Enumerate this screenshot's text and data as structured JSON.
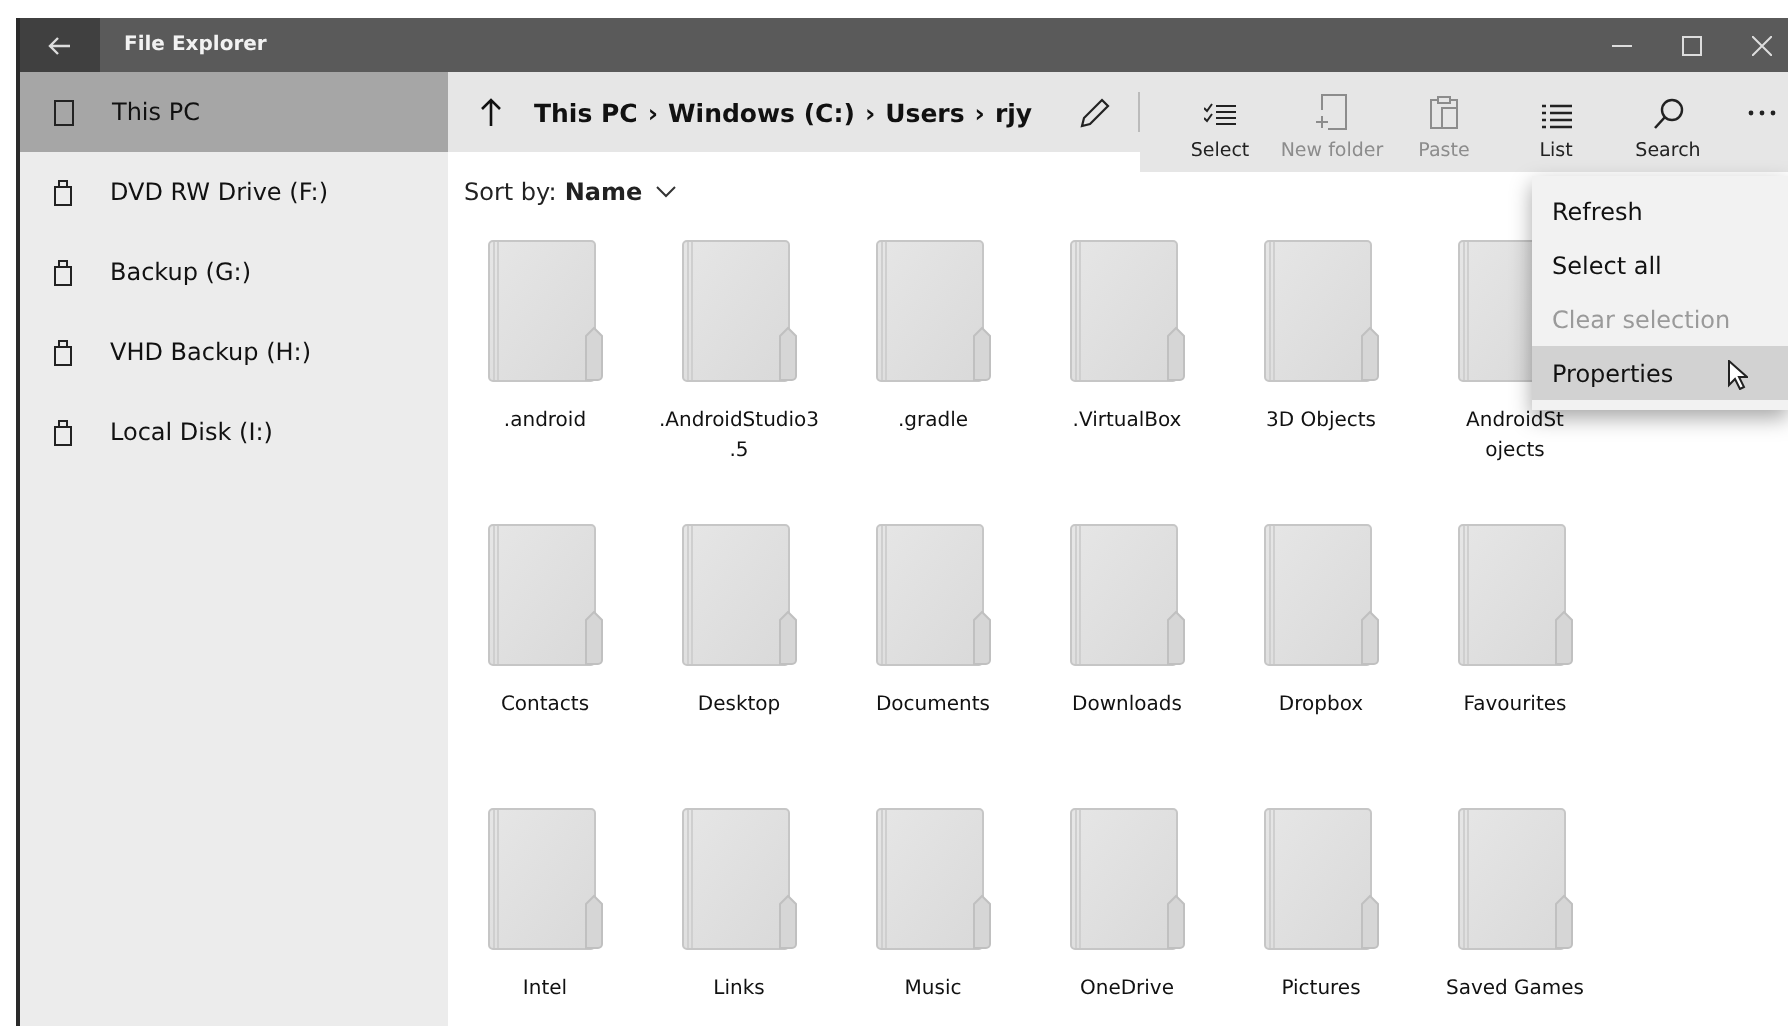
{
  "window": {
    "title": "File Explorer"
  },
  "sidebar": {
    "items": [
      {
        "label": "This PC",
        "kind": "pc",
        "selected": true
      },
      {
        "label": "DVD RW Drive (F:)",
        "kind": "drive",
        "selected": false
      },
      {
        "label": "Backup (G:)",
        "kind": "drive",
        "selected": false
      },
      {
        "label": "VHD Backup (H:)",
        "kind": "drive",
        "selected": false
      },
      {
        "label": "Local Disk (I:)",
        "kind": "drive",
        "selected": false
      }
    ]
  },
  "breadcrumb": {
    "separator": "›",
    "parts": [
      "This PC",
      "Windows (C:)",
      "Users",
      "rjy"
    ]
  },
  "toolbar": [
    {
      "label": "Select",
      "kind": "select",
      "disabled": false
    },
    {
      "label": "New folder",
      "kind": "newfolder",
      "disabled": true
    },
    {
      "label": "Paste",
      "kind": "paste",
      "disabled": true
    },
    {
      "label": "List",
      "kind": "list",
      "disabled": false
    },
    {
      "label": "Search",
      "kind": "search",
      "disabled": false
    }
  ],
  "sort": {
    "label": "Sort by:",
    "value": "Name"
  },
  "folders": [
    {
      "lines": [
        ".android"
      ]
    },
    {
      "lines": [
        ".AndroidStudio3",
        ".5"
      ]
    },
    {
      "lines": [
        ".gradle"
      ]
    },
    {
      "lines": [
        ".VirtualBox"
      ]
    },
    {
      "lines": [
        "3D Objects"
      ]
    },
    {
      "lines": [
        "AndroidSt",
        "ojects"
      ]
    },
    {
      "lines": [
        "Contacts"
      ]
    },
    {
      "lines": [
        "Desktop"
      ]
    },
    {
      "lines": [
        "Documents"
      ]
    },
    {
      "lines": [
        "Downloads"
      ]
    },
    {
      "lines": [
        "Dropbox"
      ]
    },
    {
      "lines": [
        "Favourites"
      ]
    },
    {
      "lines": [
        "Intel"
      ]
    },
    {
      "lines": [
        "Links"
      ]
    },
    {
      "lines": [
        "Music"
      ]
    },
    {
      "lines": [
        "OneDrive"
      ]
    },
    {
      "lines": [
        "Pictures"
      ]
    },
    {
      "lines": [
        "Saved Games"
      ]
    }
  ],
  "context_menu": [
    {
      "label": "Refresh",
      "disabled": false,
      "selected": false
    },
    {
      "label": "Select all",
      "disabled": false,
      "selected": false
    },
    {
      "label": "Clear selection",
      "disabled": true,
      "selected": false
    },
    {
      "label": "Properties",
      "disabled": false,
      "selected": true
    }
  ]
}
